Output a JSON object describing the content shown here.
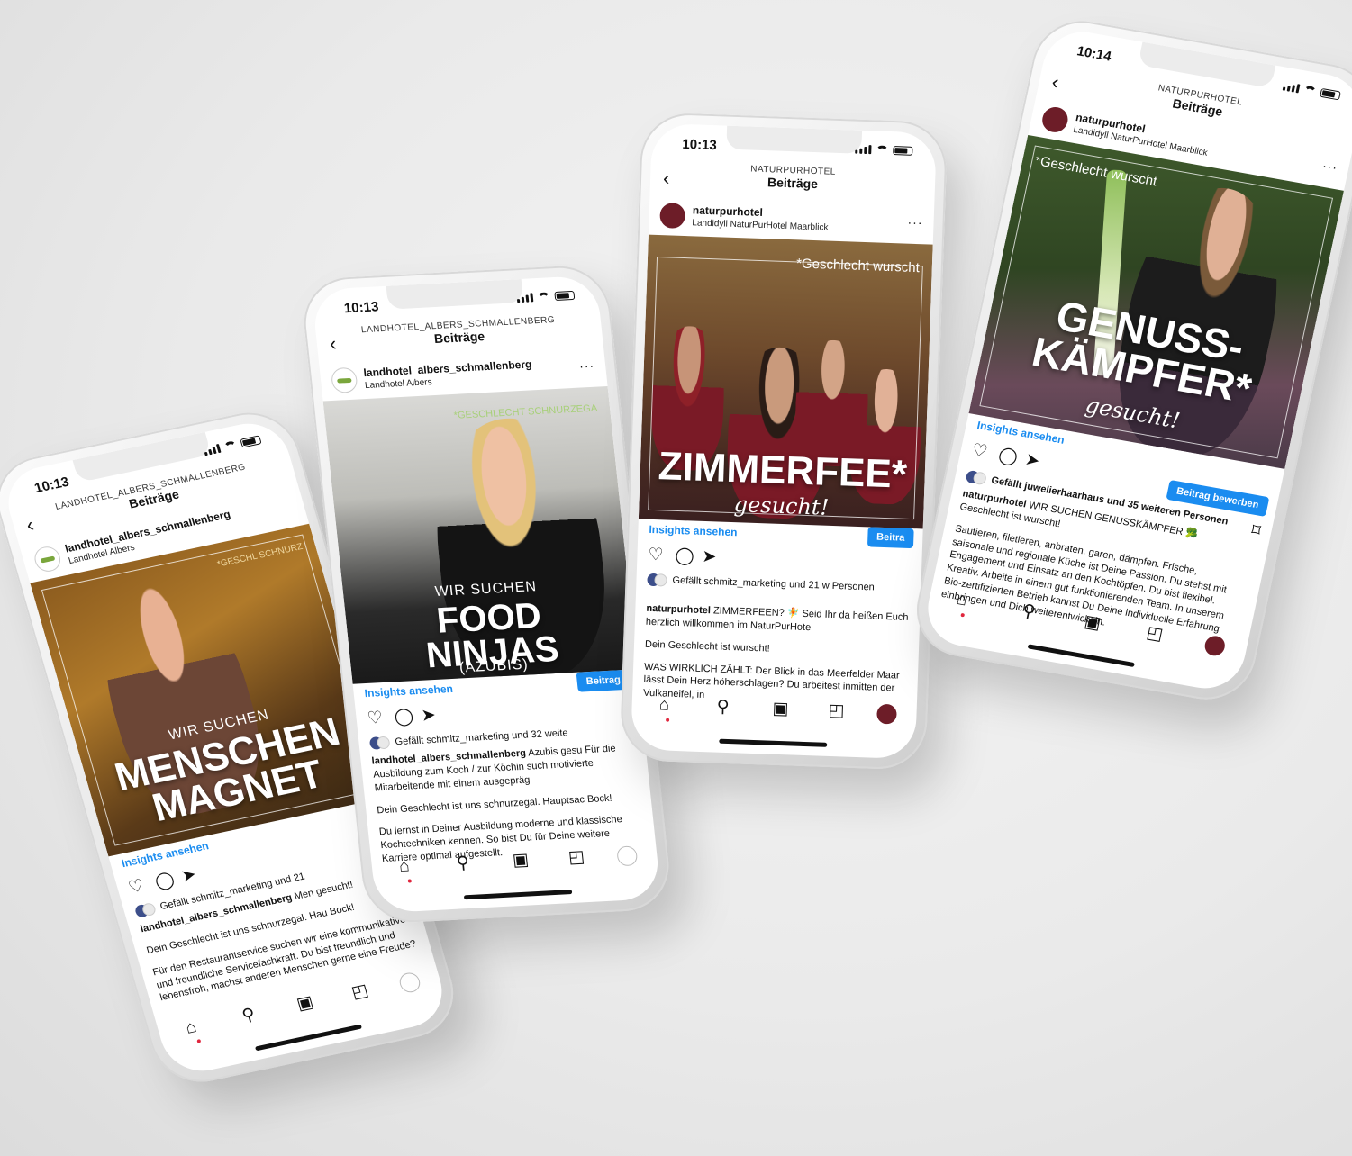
{
  "phones": [
    {
      "time": "10:13",
      "account": "LANDHOTEL_ALBERS_SCHMALLENBERG",
      "page_title": "Beiträge",
      "username": "landhotel_albers_schmallenberg",
      "location": "Landhotel Albers",
      "tag_line": "*GESCHL SCHNURZ",
      "kicker": "WIR SUCHEN",
      "headline": "MENSCHEN MAGNET",
      "insights": "Insights ansehen",
      "likes": "Gefällt schmitz_marketing und 21",
      "caption_user": "landhotel_albers_schmallenberg",
      "caption_text": "Men gesucht!",
      "p2": "Dein Geschlecht ist uns schnurzegal. Hau Bock!",
      "p3": "Für den Restaurantservice suchen wir eine kommunikative und freundliche Servicefachkraft. Du bist freundlich und lebensfroh, machst anderen Menschen gerne eine Freude?"
    },
    {
      "time": "10:13",
      "account": "LANDHOTEL_ALBERS_SCHMALLENBERG",
      "page_title": "Beiträge",
      "username": "landhotel_albers_schmallenberg",
      "location": "Landhotel Albers",
      "tag_line": "*GESCHLECHT SCHNURZEGA",
      "kicker": "WIR SUCHEN",
      "headline": "FOOD NINJAS",
      "paren": "(AZUBIS)",
      "insights": "Insights ansehen",
      "promote": "Beitrag",
      "likes": "Gefällt schmitz_marketing und 32 weite",
      "caption_user": "landhotel_albers_schmallenberg",
      "caption_text": "Azubis gesu Für die Ausbildung zum Koch / zur Köchin such motivierte Mitarbeitende mit einem ausgepräg",
      "p2": "Dein Geschlecht ist uns schnurzegal. Hauptsac Bock!",
      "p3": "Du lernst in Deiner Ausbildung moderne und klassische Kochtechniken kennen. So bist Du für Deine weitere Karriere optimal aufgestellt."
    },
    {
      "time": "10:13",
      "account": "NATURPURHOTEL",
      "page_title": "Beiträge",
      "username": "naturpurhotel",
      "location": "Landidyll NaturPurHotel Maarblick",
      "tag_line": "*Geschlecht wurscht",
      "headline": "ZIMMERFEE*",
      "sub": "gesucht!",
      "insights": "Insights ansehen",
      "promote": "Beitra",
      "likes": "Gefällt schmitz_marketing und 21 w Personen",
      "caption_user": "naturpurhotel",
      "caption_text": "ZIMMERFEEN? 🧚 Seid Ihr da heißen Euch herzlich willkommen im NaturPurHote",
      "p2": "Dein Geschlecht ist wurscht!",
      "p3": "WAS WIRKLICH ZÄHLT: Der Blick in das Meerfelder Maar lässt Dein Herz höherschlagen? Du arbeitest inmitten der Vulkaneifel, in"
    },
    {
      "time": "10:14",
      "account": "NATURPURHOTEL",
      "page_title": "Beiträge",
      "username": "naturpurhotel",
      "location": "Landidyll NaturPurHotel Maarblick",
      "tag_line": "*Geschlecht wurscht",
      "headline": "GENUSS- KÄMPFER*",
      "sub": "gesucht!",
      "insights": "Insights ansehen",
      "promote": "Beitrag bewerben",
      "likes": "Gefällt juwelierhaarhaus und 35 weiteren Personen",
      "caption_user": "naturpurhotel",
      "caption_text": "WIR SUCHEN GENUSSKÄMPFER 🥦 Geschlecht ist wurscht!",
      "p2": "Sautieren, filetieren, anbraten, garen, dämpfen. Frische, saisonale und regionale Küche ist Deine Passion. Du stehst mit Engagement und Einsatz an den Kochtöpfen. Du bist flexibel. Kreativ. Arbeite in einem gut funktionierenden Team. In unserem Bio-zertifizierten Betrieb kannst Du Deine individuelle Erfahrung einbringen und Dich weiterentwickeln.",
      "p3": ""
    }
  ],
  "icons": {
    "back": "‹",
    "more": "···",
    "heart": "♡",
    "comment": "◯",
    "share": "➤",
    "save": "⌑",
    "home": "⌂",
    "search": "⚲",
    "reels": "▣",
    "shop": "◰"
  },
  "colors": {
    "accent": "#1a8cf0",
    "brand_naturpur": "#6d1d28",
    "brand_albers": "#7aa63c"
  }
}
